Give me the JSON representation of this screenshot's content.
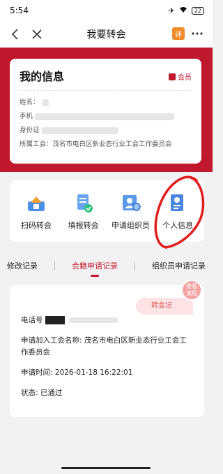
{
  "status_bar": {
    "time": "5:54",
    "battery": "22"
  },
  "nav": {
    "title": "我要转会",
    "right_icon_text": "评"
  },
  "info": {
    "title": "我的信息",
    "badge": "会员",
    "name_label": "姓名：",
    "phone_label": "手机",
    "id_label": "身份证",
    "union_label": "所属工会：",
    "union_value": "茂名市电白区新业态行业工会工作委员会"
  },
  "actions": [
    {
      "label": "扫码转会",
      "icon": "scan-house-icon"
    },
    {
      "label": "填报转会",
      "icon": "form-check-icon"
    },
    {
      "label": "申请组织员",
      "icon": "organizer-apply-icon"
    },
    {
      "label": "个人信息",
      "icon": "personal-info-icon"
    }
  ],
  "tabs": {
    "items": [
      "修改记录",
      "会籍申请记录",
      "组织员申请记录"
    ],
    "active_index": 1
  },
  "record": {
    "phone_label": "电话号",
    "apply_union_label": "申请加入工会名称:",
    "apply_union_value": "茂名市电白区新业态行业工会工作委员会",
    "apply_time_label": "申请时间:",
    "apply_time_value": "2026-01-18 16:22:01",
    "status_label": "状态:",
    "status_value": "已通过",
    "tag": "转会记",
    "flow_button": [
      "查看",
      "流程"
    ]
  },
  "colors": {
    "primary": "#c0182c",
    "annotation": "#e01e1e"
  }
}
